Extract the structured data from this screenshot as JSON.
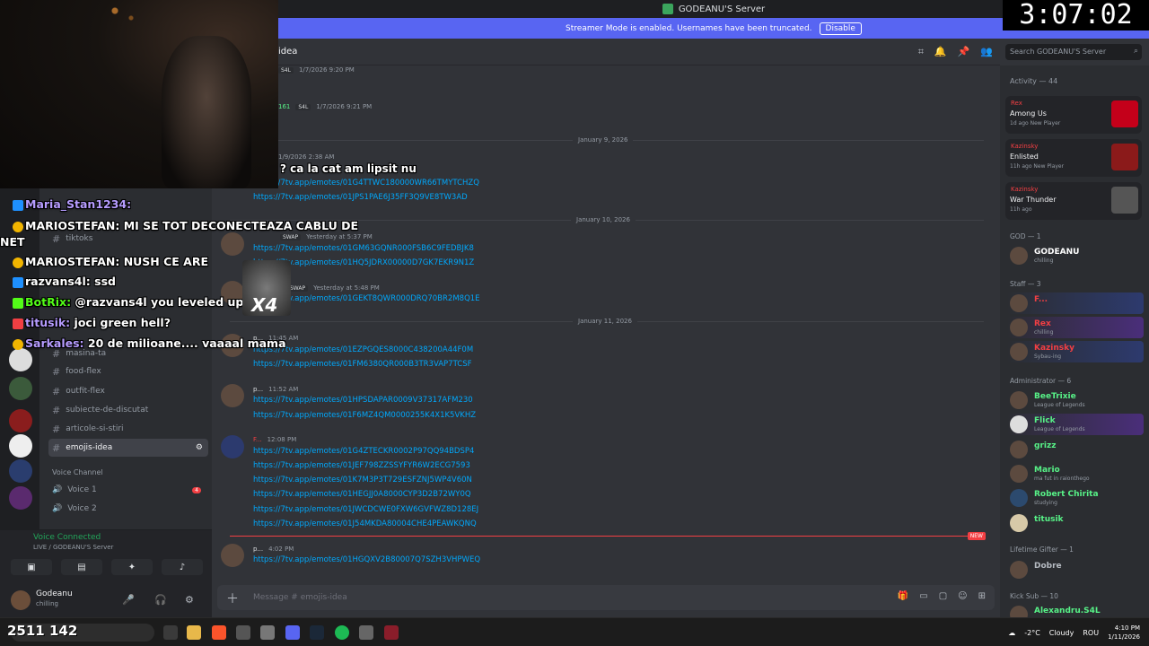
{
  "window": {
    "server_title": "GODEANU'S Server"
  },
  "banner": {
    "text": "Streamer Mode is enabled. Usernames have been truncated.",
    "button": "Disable"
  },
  "timer": "3:07:02",
  "channel_header": {
    "name": "idea"
  },
  "search": {
    "placeholder": "Search GODEANU'S Server"
  },
  "channels": [
    {
      "label": "tiktoks"
    },
    {
      "label": "masina-ta"
    },
    {
      "label": "food-flex"
    },
    {
      "label": "outfit-flex"
    },
    {
      "label": "subiecte-de-discutat"
    },
    {
      "label": "articole-si-stiri"
    },
    {
      "label": "emojis-idea"
    }
  ],
  "voice": {
    "category": "Voice Channel",
    "channels": [
      {
        "label": "Voice 1",
        "badge": "4"
      },
      {
        "label": "Voice 2"
      }
    ],
    "connected": "Voice Connected",
    "connected_sub": "LIVE / GODEANU'S Server"
  },
  "user": {
    "name": "Godeanu",
    "status": "chilling"
  },
  "messages": {
    "top_meta": [
      {
        "tag": "S4L",
        "time": "1/7/2026 9:20 PM"
      },
      {
        "count": "161",
        "tag": "S4L",
        "time": "1/7/2026 9:21 PM"
      }
    ],
    "dividers": [
      "January 9, 2026",
      "January 10, 2026",
      "January 11, 2026"
    ],
    "jan9": {
      "time": "1/9/2026 2:38 AM",
      "links": [
        "https://7tv.app/emotes/01G4TTWC180000WR66TMYTCHZQ",
        "https://7tv.app/emotes/01JPS1PAE6J35FF3Q9VE8TW3AD"
      ]
    },
    "jan10": [
      {
        "tag": "SWAP",
        "time": "Yesterday at 5:37 PM",
        "links": [
          "https://7tv.app/emotes/01GM63GQNR000FSB6C9FEDBJK8",
          "https://7tv.app/emotes/01HQ5JDRX00000D7GK7EKR9N1Z"
        ]
      },
      {
        "tag": "SWAP",
        "time": "Yesterday at 5:48 PM",
        "links": [
          "https://7tv.app/emotes/01GEKT8QWR000DRQ70BR2M8Q1E"
        ]
      }
    ],
    "jan11": [
      {
        "name": "p...",
        "time": "11:45 AM",
        "links": [
          "https://7tv.app/emotes/01EZPGQES8000C438200A44F0M",
          "https://7tv.app/emotes/01FM6380QR000B3TR3VAP7TCSF"
        ]
      },
      {
        "name": "p...",
        "time": "11:52 AM",
        "links": [
          "https://7tv.app/emotes/01HPSDAPAR0009V37317AFM230",
          "https://7tv.app/emotes/01F6MZ4QM0000255K4X1K5VKHZ"
        ]
      },
      {
        "name": "F...",
        "time": "12:08 PM",
        "links": [
          "https://7tv.app/emotes/01G4ZTECKR0002P97QQ94BDSP4",
          "https://7tv.app/emotes/01JEF798ZZSSYFYR6W2ECG7593",
          "https://7tv.app/emotes/01K7M3P3T729ESFZNJ5WP4V60N",
          "https://7tv.app/emotes/01HEGJJ0A8000CYP3D2B72WY0Q",
          "https://7tv.app/emotes/01JWCDCWE0FXW6GVFWZ8D128EJ",
          "https://7tv.app/emotes/01J54MKDA80004CHE4PEAWKQNQ"
        ]
      },
      {
        "name": "p...",
        "time": "4:02 PM",
        "links": [
          "https://7tv.app/emotes/01HGQXV2B80007Q7SZH3VHPWEQ"
        ]
      }
    ],
    "new_badge": "NEW"
  },
  "composer": {
    "placeholder": "Message # emojis-idea"
  },
  "members": {
    "activity_header": "Activity — 44",
    "activities": [
      {
        "name": "Rex",
        "game": "Among Us",
        "meta": "1d ago  New Player"
      },
      {
        "name": "Kazinsky",
        "game": "Enlisted",
        "meta": "11h ago  New Player"
      },
      {
        "name": "Kazinsky",
        "game": "War Thunder",
        "meta": "11h ago"
      }
    ],
    "roles": [
      {
        "label": "GOD — 1",
        "members": [
          {
            "name": "GODEANU",
            "status": "chilling",
            "color": "#ffffff"
          }
        ]
      },
      {
        "label": "Staff — 3",
        "members": [
          {
            "name": "F...",
            "status": "",
            "color": "#f23f43"
          },
          {
            "name": "Rex",
            "status": "chilling",
            "color": "#f23f43"
          },
          {
            "name": "Kazinsky",
            "status": "Sybau-ing",
            "color": "#f23f43"
          }
        ]
      },
      {
        "label": "Administrator — 6",
        "members": [
          {
            "name": "BeeTrixie",
            "status": "League of Legends",
            "color": "#57f287"
          },
          {
            "name": "Flick",
            "status": "League of Legends",
            "color": "#57f287"
          },
          {
            "name": "grizz",
            "status": "",
            "color": "#57f287"
          },
          {
            "name": "Mario",
            "status": "ma fut in raionthego",
            "color": "#57f287"
          },
          {
            "name": "Robert Chirita",
            "status": "studying",
            "color": "#57f287"
          },
          {
            "name": "titusik",
            "status": "",
            "color": "#57f287"
          }
        ]
      },
      {
        "label": "Lifetime Gifter — 1",
        "members": [
          {
            "name": "Dobre",
            "status": "",
            "color": "#b5bac1"
          }
        ]
      },
      {
        "label": "Kick Sub — 10",
        "members": [
          {
            "name": "Alexandru.S4L",
            "status": "",
            "color": "#57f287"
          }
        ]
      }
    ]
  },
  "chat_overlay": [
    {
      "user": "Maria_Stan1234:",
      "msg": "",
      "user_color": "#b69cff"
    },
    {
      "user": "MARIOSTEFAN:",
      "msg": "MI SE TOT DECONECTEAZA CABLU DE",
      "user_color": "#ffffff"
    },
    {
      "user": "NET",
      "msg": "",
      "user_color": "#ffffff"
    },
    {
      "user": "MARIOSTEFAN:",
      "msg": "NUSH CE ARE",
      "user_color": "#ffffff"
    },
    {
      "user": "razvans4l:",
      "msg": "ssd",
      "user_color": "#ffffff"
    },
    {
      "user": "BotRix:",
      "msg": "@razvans4l you leveled up to",
      "user_color": "#53fc18"
    },
    {
      "user": "titusik:",
      "msg": "joci green hell?",
      "user_color": "#b69cff"
    },
    {
      "user": "Sarkales:",
      "msg": "20 de milioane.... vaaaal mama",
      "user_color": "#b69cff"
    }
  ],
  "overlay_extra": {
    "emote_label": "X4",
    "footer": "2511 142",
    "message_preview": "? ca la cat am lipsit nu"
  },
  "taskbar": {
    "weather_temp": "-2°C",
    "weather_text": "Cloudy",
    "lang": "ROU",
    "time": "4:10 PM",
    "date": "1/11/2026"
  }
}
